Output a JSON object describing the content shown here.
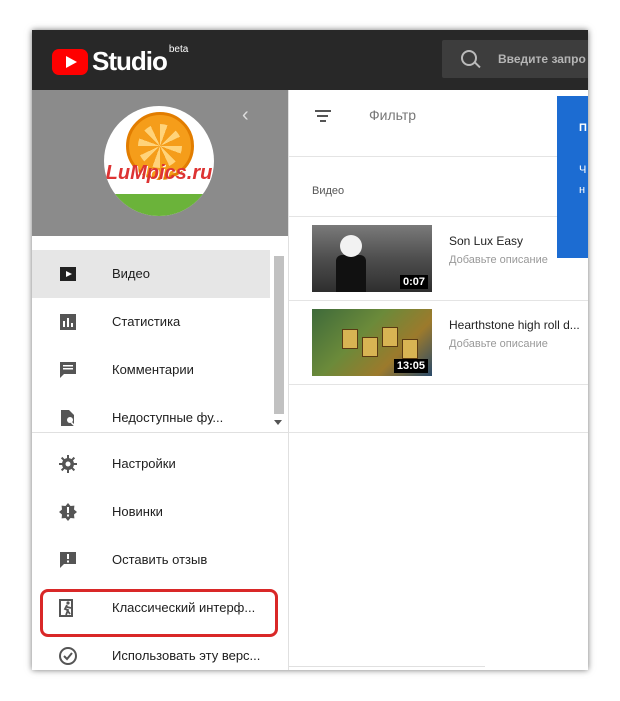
{
  "header": {
    "studio": "Studio",
    "beta": "beta",
    "search_placeholder": "Введите запро"
  },
  "sidebar": {
    "profile_text": "LuMpics.ru",
    "items": [
      {
        "label": "Видео",
        "icon": "video-icon",
        "active": true
      },
      {
        "label": "Статистика",
        "icon": "analytics-icon"
      },
      {
        "label": "Комментарии",
        "icon": "comments-icon"
      },
      {
        "label": "Недоступные фу...",
        "icon": "unavailable-icon"
      },
      {
        "label": "Настройки",
        "icon": "gear-icon"
      },
      {
        "label": "Новинки",
        "icon": "whats-new-icon"
      },
      {
        "label": "Оставить отзыв",
        "icon": "feedback-icon"
      },
      {
        "label": "Классический интерф...",
        "icon": "classic-exit-icon"
      },
      {
        "label": "Использовать эту верс...",
        "icon": "check-circle-icon"
      }
    ]
  },
  "main": {
    "filter_label": "Фильтр",
    "column_header": "Видео",
    "videos": [
      {
        "title": "Son Lux Easy",
        "description": "Добавьте описание",
        "duration": "0:07"
      },
      {
        "title": "Hearthstone high roll d...",
        "description": "Добавьте описание",
        "duration": "13:05"
      }
    ],
    "promo": {
      "line1": "П",
      "line2": "Ч",
      "line3": "н"
    }
  },
  "colors": {
    "topbar": "#282828",
    "brand_red": "#ff0000",
    "promo_blue": "#1c6cd2",
    "highlight": "#d92828"
  }
}
